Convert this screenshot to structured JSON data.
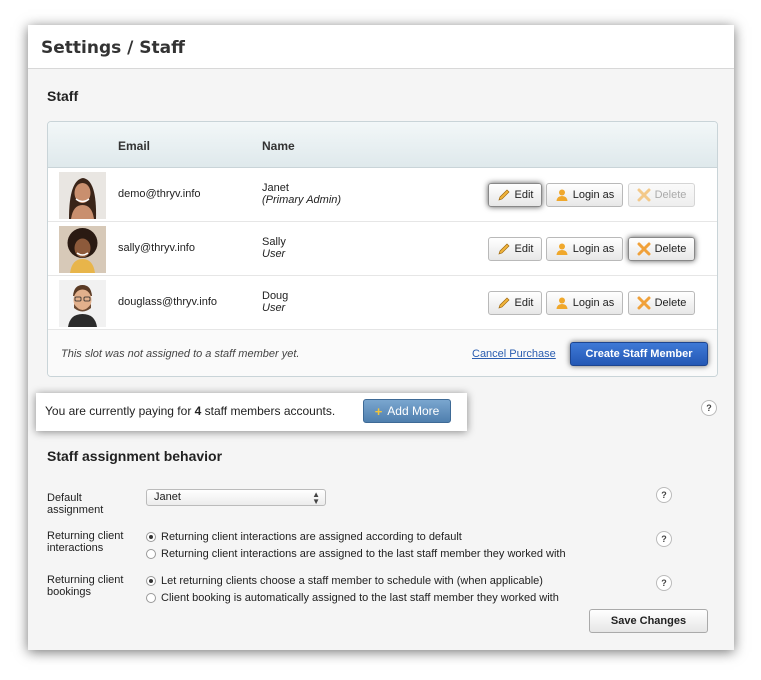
{
  "page": {
    "title": "Settings / Staff"
  },
  "staff_section": {
    "title": "Staff",
    "columns": {
      "email": "Email",
      "name": "Name"
    },
    "rows": [
      {
        "email": "demo@thryv.info",
        "name": "Janet",
        "role": "(Primary Admin)",
        "edit": "Edit",
        "login": "Login as",
        "delete": "Delete",
        "delete_enabled": false
      },
      {
        "email": "sally@thryv.info",
        "name": "Sally",
        "role": "User",
        "edit": "Edit",
        "login": "Login as",
        "delete": "Delete",
        "delete_enabled": true
      },
      {
        "email": "douglass@thryv.info",
        "name": "Doug",
        "role": "User",
        "edit": "Edit",
        "login": "Login as",
        "delete": "Delete",
        "delete_enabled": true
      }
    ],
    "slot_note": "This slot was not assigned to a staff member yet.",
    "cancel_purchase": "Cancel Purchase",
    "create_staff_member": "Create Staff Member"
  },
  "paying": {
    "text_before": "You are currently paying for ",
    "count": "4",
    "text_after": " staff members accounts.",
    "add_more": "Add More"
  },
  "assignment": {
    "title": "Staff assignment behavior",
    "default_label": "Default assignment",
    "default_value": "Janet",
    "interactions_label": "Returning client interactions",
    "interactions_options": [
      {
        "label": "Returning client interactions are assigned according to default",
        "checked": true
      },
      {
        "label": "Returning client interactions are assigned to the last staff member they worked with",
        "checked": false
      }
    ],
    "bookings_label": "Returning client bookings",
    "bookings_options": [
      {
        "label": "Let returning clients choose a staff member to schedule with (when applicable)",
        "checked": true
      },
      {
        "label": "Client booking is automatically assigned to the last staff member they worked with",
        "checked": false
      }
    ],
    "save": "Save Changes",
    "help": "?"
  },
  "colors": {
    "primary_blue": "#2458b5",
    "add_more_blue": "#4f7fae",
    "table_header": "#dfe9ec",
    "link": "#2a5db0"
  },
  "icons": {
    "edit": "pencil-icon",
    "login": "user-icon",
    "delete": "x-icon",
    "add": "plus-icon",
    "help": "question-icon"
  }
}
